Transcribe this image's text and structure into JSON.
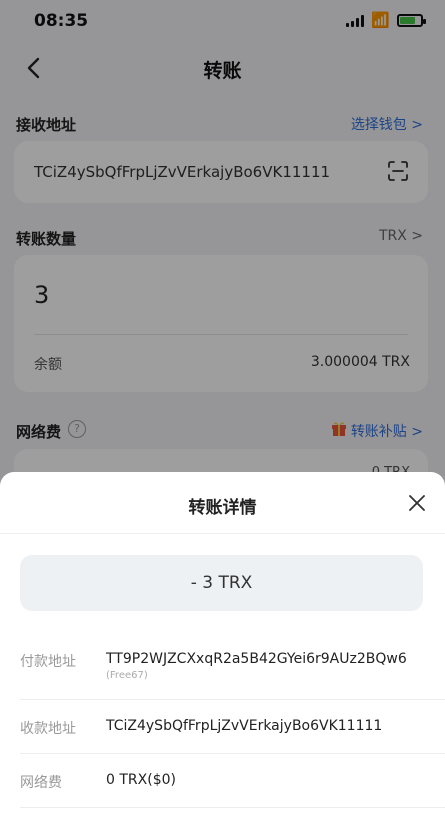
{
  "status_bar": {
    "time": "08:35"
  },
  "nav": {
    "title": "转账"
  },
  "recipient": {
    "label": "接收地址",
    "select_wallet": "选择钱包 >",
    "address": "TCiZ4ySbQfFrpLjZvVErkajyBo6VK11111"
  },
  "amount_section": {
    "label": "转账数量",
    "token": "TRX >",
    "amount": "3",
    "balance_label": "余额",
    "balance_value": "3.000004 TRX"
  },
  "fee_section": {
    "label": "网络费",
    "subsidy": "转账补贴 >",
    "partial_value": "0 TRX"
  },
  "sheet": {
    "title": "转账详情",
    "amount": "- 3 TRX",
    "rows": [
      {
        "label": "付款地址",
        "value": "TT9P2WJZCXxqR2a5B42GYei6r9AUz2BQw6",
        "sub": "(Free67)"
      },
      {
        "label": "收款地址",
        "value": "TCiZ4ySbQfFrpLjZvVErkajyBo6VK11111"
      },
      {
        "label": "网络费",
        "value": "0 TRX($0)"
      }
    ]
  },
  "colors": {
    "link": "#2f6fd8",
    "background": "#f2f3f5"
  }
}
